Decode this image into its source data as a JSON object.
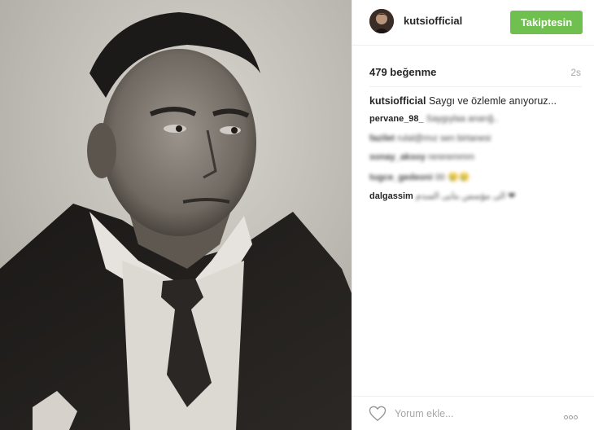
{
  "post": {
    "username": "kutsiofficial",
    "follow_label": "Takiptesin",
    "likes": "479 beğenme",
    "time": "2s",
    "caption_user": "kutsiofficial",
    "caption_text": "Saygı ve özlemle anıyoruz...",
    "comments": [
      {
        "user": "pervane_98_",
        "text": "Saygıylaa anarığ.."
      },
      {
        "user": "fazilet",
        "text": "rulal@mız sen birtanesi"
      },
      {
        "user": "sonay_aksoy",
        "text": "rereremmm"
      },
      {
        "user": "tugce_gedeoni",
        "text": "00 😢😢"
      },
      {
        "user": "dalgassim",
        "text": "الى مؤسس بنايى السدم ❤"
      }
    ],
    "comment_placeholder": "Yorum ekle..."
  },
  "colors": {
    "follow_button": "#70c050",
    "secondary_text": "#a5a7aa",
    "divider": "#efefef"
  },
  "icons": {
    "like": "heart-outline-icon",
    "more": "ellipsis-icon"
  }
}
